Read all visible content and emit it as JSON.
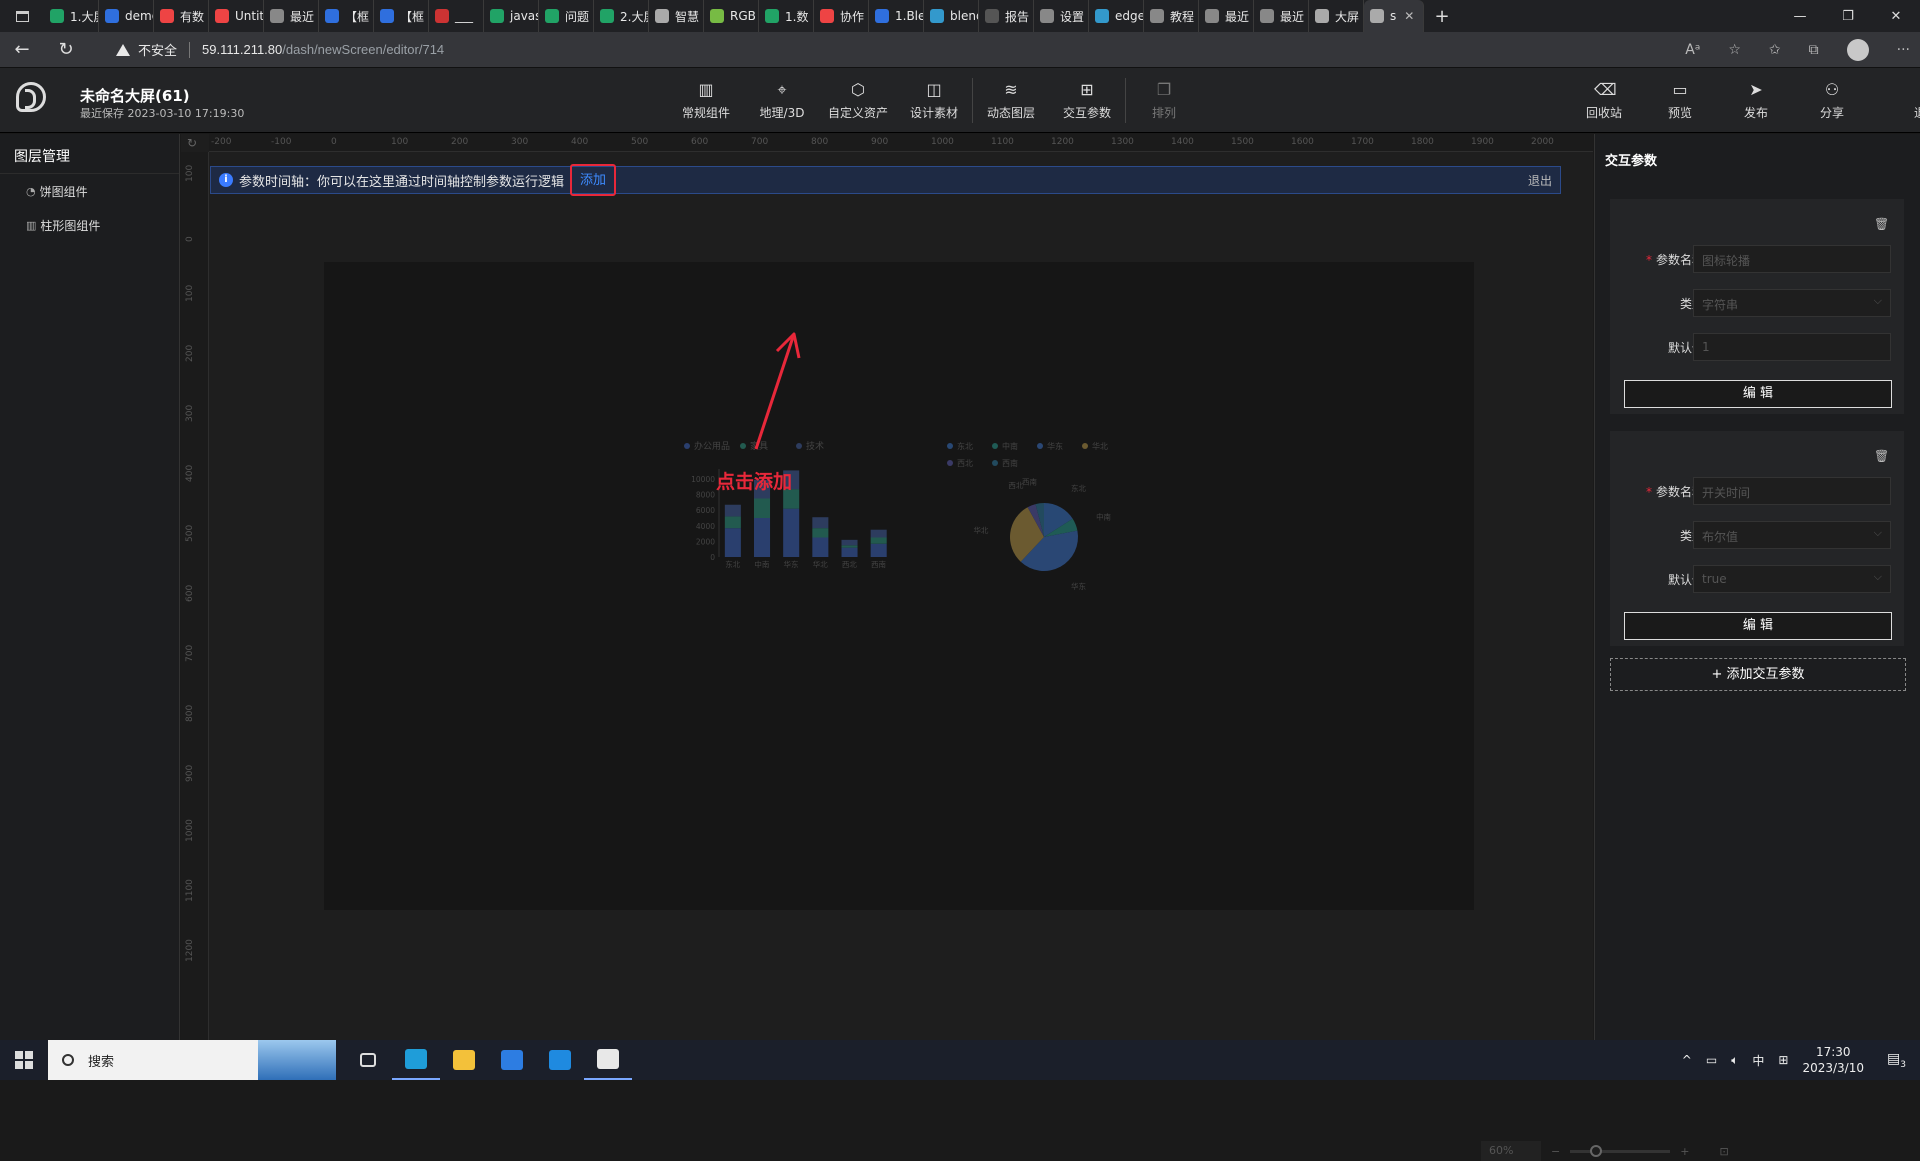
{
  "browser": {
    "tabs": [
      {
        "label": "1.大屏",
        "color": "#21a366"
      },
      {
        "label": "demo",
        "color": "#2f6fde"
      },
      {
        "label": "有数",
        "color": "#e44"
      },
      {
        "label": "Untit",
        "color": "#e44"
      },
      {
        "label": "最近",
        "color": "#888"
      },
      {
        "label": "【框",
        "color": "#2f6fde"
      },
      {
        "label": "【框",
        "color": "#2f6fde"
      },
      {
        "label": "___",
        "color": "#c33"
      },
      {
        "label": "javas",
        "color": "#21a366"
      },
      {
        "label": "问题",
        "color": "#21a366"
      },
      {
        "label": "2.大屏",
        "color": "#21a366"
      },
      {
        "label": "智慧",
        "color": "#aaa"
      },
      {
        "label": "RGB",
        "color": "#7b4"
      },
      {
        "label": "1.数",
        "color": "#21a366"
      },
      {
        "label": "协作",
        "color": "#e44"
      },
      {
        "label": "1.Ble",
        "color": "#2f6fde"
      },
      {
        "label": "blend",
        "color": "#39c"
      },
      {
        "label": "报告",
        "color": "#555"
      },
      {
        "label": "设置",
        "color": "#888"
      },
      {
        "label": "edge",
        "color": "#39c"
      },
      {
        "label": "教程",
        "color": "#888"
      },
      {
        "label": "最近",
        "color": "#888"
      },
      {
        "label": "最近",
        "color": "#888"
      },
      {
        "label": "大屏",
        "color": "#aaa"
      },
      {
        "label": "s",
        "color": "#aaa"
      }
    ],
    "active_tab_index": 24,
    "security_label": "不安全",
    "url_host": "59.111.211.80",
    "url_path": "/dash/newScreen/editor/714"
  },
  "header": {
    "project_title": "未命名大屏(61)",
    "last_saved": "最近保存 2023-03-10 17:19:30",
    "tools_center": [
      {
        "label": "常规组件",
        "icon": "bar-chart-icon",
        "glyph": "▥"
      },
      {
        "label": "地理/3D",
        "icon": "map-pin-icon",
        "glyph": "⌖"
      },
      {
        "label": "自定义资产",
        "icon": "hexagon-icon",
        "glyph": "⬡"
      },
      {
        "label": "设计素材",
        "icon": "image-icon",
        "glyph": "◫"
      },
      {
        "label": "动态图层",
        "icon": "layers-icon",
        "glyph": "≋"
      },
      {
        "label": "交互参数",
        "icon": "sliders-icon",
        "glyph": "⊞"
      },
      {
        "label": "排列",
        "icon": "arrange-icon",
        "glyph": "❐"
      }
    ],
    "tools_right": [
      {
        "label": "回收站",
        "icon": "recycle-bin-icon",
        "glyph": "⌫"
      },
      {
        "label": "预览",
        "icon": "preview-icon",
        "glyph": "▭"
      },
      {
        "label": "发布",
        "icon": "send-icon",
        "glyph": "➤"
      },
      {
        "label": "分享",
        "icon": "share-icon",
        "glyph": "⚇"
      },
      {
        "label": "退出",
        "icon": "exit-icon",
        "glyph": "⇥"
      }
    ]
  },
  "left_panel": {
    "title": "图层管理",
    "layers": [
      {
        "label": "饼图组件",
        "icon": "pie-icon",
        "glyph": "◔"
      },
      {
        "label": "柱形图组件",
        "icon": "bar-icon",
        "glyph": "▥"
      }
    ]
  },
  "canvas": {
    "ruler_top": [
      "-200",
      "-100",
      "0",
      "100",
      "200",
      "300",
      "400",
      "500",
      "600",
      "700",
      "800",
      "900",
      "1000",
      "1100",
      "1200",
      "1300",
      "1400",
      "1500",
      "1600",
      "1700",
      "1800",
      "1900",
      "2000"
    ],
    "ruler_left": [
      "100",
      "0",
      "100",
      "200",
      "300",
      "400",
      "500",
      "600",
      "700",
      "800",
      "900",
      "1000",
      "1100",
      "1200"
    ],
    "timeline_message": "参数时间轴：你可以在这里通过时间轴控制参数运行逻辑",
    "timeline_add": "添加",
    "timeline_exit": "退出",
    "annotation": "点击添加",
    "zoom_value": "60%",
    "zoom_level": 0.2
  },
  "right_panel": {
    "title": "交互参数",
    "params": [
      {
        "name_label": "参数名称",
        "name_placeholder": "图标轮播",
        "type_label": "类型",
        "type_value": "字符串",
        "default_label": "默认值",
        "default_value": "1",
        "edit_label": "编 辑"
      },
      {
        "name_label": "参数名称",
        "name_placeholder": "开关时间",
        "type_label": "类型",
        "type_value": "布尔值",
        "default_label": "默认值",
        "default_value": "true",
        "edit_label": "编 辑"
      }
    ],
    "add_param": "+ 添加交互参数"
  },
  "chart_data": [
    {
      "type": "bar",
      "categories": [
        "东北",
        "中南",
        "华东",
        "华北",
        "西北",
        "西南"
      ],
      "series": [
        {
          "name": "办公用品",
          "values": [
            3700,
            5000,
            6200,
            2500,
            1200,
            1700
          ]
        },
        {
          "name": "家具",
          "values": [
            1500,
            2500,
            2500,
            1200,
            300,
            800
          ]
        },
        {
          "name": "技术",
          "values": [
            1500,
            2400,
            2400,
            1400,
            700,
            1000
          ]
        }
      ],
      "y_ticks": [
        "10000",
        "8000",
        "6000",
        "4000",
        "2000",
        "0"
      ],
      "ylim": [
        0,
        10000
      ],
      "stacked": true,
      "legend_position": "top-left",
      "colors": [
        "#2a3f6e",
        "#225a4f",
        "#2d3c5e"
      ]
    },
    {
      "type": "pie",
      "labels": [
        "东北",
        "中南",
        "华东",
        "华北",
        "西北",
        "西南"
      ],
      "values": [
        16,
        6,
        40,
        30,
        4,
        4
      ],
      "slice_labels": [
        "东北",
        "中南",
        "华东",
        "华北",
        "西北",
        "西南"
      ],
      "legend_position": "top",
      "colors": [
        "#284874",
        "#1f5b55",
        "#2a4774",
        "#6b5a30",
        "#3a3a66",
        "#224a5e"
      ]
    }
  ],
  "taskbar": {
    "search_label": "搜索",
    "apps": [
      {
        "icon": "task-view-icon",
        "color": "#ddd"
      },
      {
        "icon": "edge-browser-icon",
        "color": "#1f9dd9"
      },
      {
        "icon": "file-explorer-icon",
        "color": "#f3c13a"
      },
      {
        "icon": "store-icon",
        "color": "#2d7de2"
      },
      {
        "icon": "mail-icon",
        "color": "#1f8ae0"
      },
      {
        "icon": "app-icon",
        "color": "#e8e8e8"
      }
    ],
    "ime": "中",
    "time": "17:30",
    "date": "2023/3/10",
    "notification_count": "3"
  }
}
